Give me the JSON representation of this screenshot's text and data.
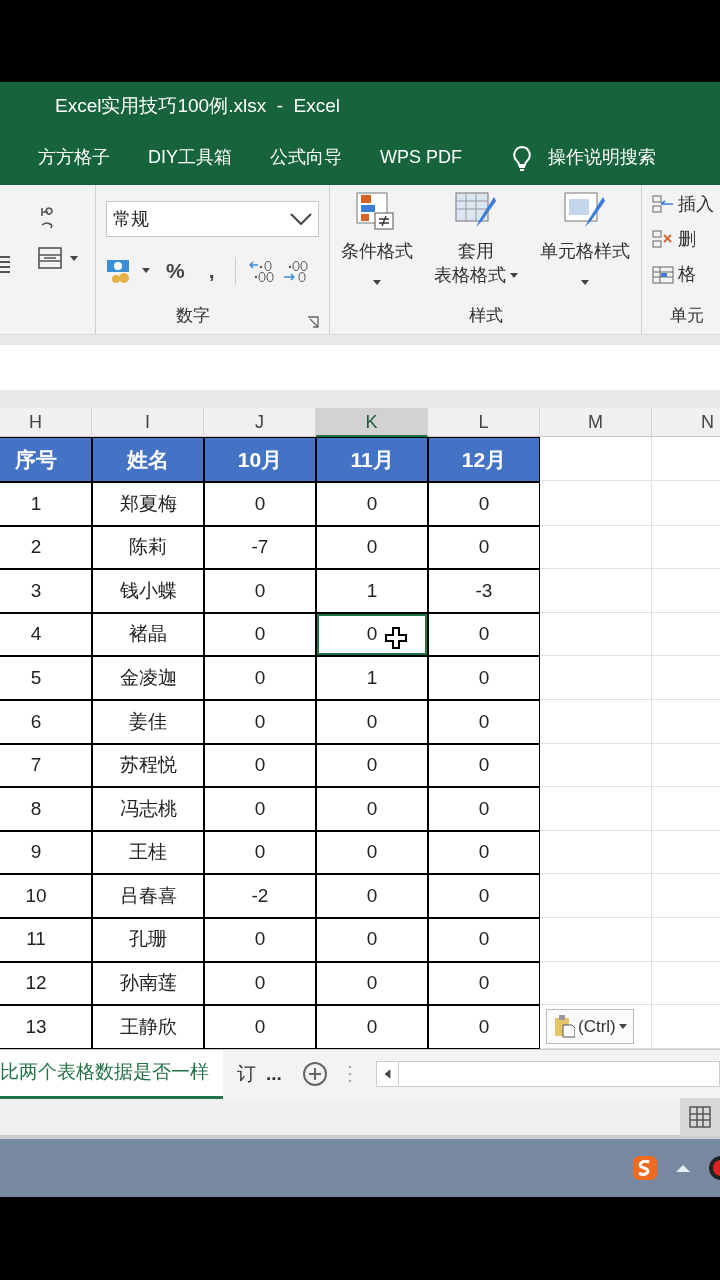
{
  "window": {
    "title": "Excel实用技巧100例.xlsx  -  Excel"
  },
  "menu_tabs": [
    {
      "label": "方方格子"
    },
    {
      "label": "DIY工具箱"
    },
    {
      "label": "公式向导"
    },
    {
      "label": "WPS PDF"
    }
  ],
  "tell_me": {
    "placeholder": "操作说明搜索"
  },
  "ribbon": {
    "number_format": "常规",
    "number_buttons": [
      "%",
      ","
    ],
    "number_group": "数字",
    "style_buttons": [
      {
        "lines": [
          "条件格式"
        ]
      },
      {
        "lines": [
          "套用",
          "表格格式"
        ]
      },
      {
        "lines": [
          "单元格样式"
        ]
      }
    ],
    "style_group": "样式",
    "cell_buttons": [
      "插入",
      "删",
      "格"
    ],
    "cells_group": "单元"
  },
  "columns": [
    {
      "label": "H",
      "selected": false
    },
    {
      "label": "I",
      "selected": false
    },
    {
      "label": "J",
      "selected": false
    },
    {
      "label": "K",
      "selected": true
    },
    {
      "label": "L",
      "selected": false
    },
    {
      "label": "M",
      "selected": false
    },
    {
      "label": "N",
      "selected": false
    }
  ],
  "table": {
    "header": [
      "序号",
      "姓名",
      "10月",
      "11月",
      "12月"
    ],
    "rows": [
      {
        "cells": [
          "1",
          "郑夏梅",
          "0",
          "0",
          "0"
        ],
        "selected": [
          false,
          false,
          false,
          false,
          false
        ]
      },
      {
        "cells": [
          "2",
          "陈莉",
          "-7",
          "0",
          "0"
        ],
        "selected": [
          false,
          false,
          false,
          false,
          false
        ]
      },
      {
        "cells": [
          "3",
          "钱小蝶",
          "0",
          "1",
          "-3"
        ],
        "selected": [
          false,
          false,
          false,
          false,
          false
        ]
      },
      {
        "cells": [
          "4",
          "褚晶",
          "0",
          "0",
          "0"
        ],
        "selected": [
          false,
          false,
          false,
          true,
          false
        ]
      },
      {
        "cells": [
          "5",
          "金凌迦",
          "0",
          "1",
          "0"
        ],
        "selected": [
          false,
          false,
          false,
          false,
          false
        ]
      },
      {
        "cells": [
          "6",
          "姜佳",
          "0",
          "0",
          "0"
        ],
        "selected": [
          false,
          false,
          false,
          false,
          false
        ]
      },
      {
        "cells": [
          "7",
          "苏程悦",
          "0",
          "0",
          "0"
        ],
        "selected": [
          false,
          false,
          false,
          false,
          false
        ]
      },
      {
        "cells": [
          "8",
          "冯志桃",
          "0",
          "0",
          "0"
        ],
        "selected": [
          false,
          false,
          false,
          false,
          false
        ]
      },
      {
        "cells": [
          "9",
          "王桂",
          "0",
          "0",
          "0"
        ],
        "selected": [
          false,
          false,
          false,
          false,
          false
        ]
      },
      {
        "cells": [
          "10",
          "吕春喜",
          "-2",
          "0",
          "0"
        ],
        "selected": [
          false,
          false,
          false,
          false,
          false
        ]
      },
      {
        "cells": [
          "11",
          "孔珊",
          "0",
          "0",
          "0"
        ],
        "selected": [
          false,
          false,
          false,
          false,
          false
        ]
      },
      {
        "cells": [
          "12",
          "孙南莲",
          "0",
          "0",
          "0"
        ],
        "selected": [
          false,
          false,
          false,
          false,
          false
        ]
      },
      {
        "cells": [
          "13",
          "王静欣",
          "0",
          "0",
          "0"
        ],
        "selected": [
          false,
          false,
          false,
          false,
          false
        ]
      }
    ]
  },
  "paste_options": {
    "label": "(Ctrl)"
  },
  "sheet_tabs": [
    {
      "label": "比两个表格数据是否一样",
      "selected": true
    },
    {
      "label": "订",
      "selected": false
    }
  ],
  "more_tabs": "..."
}
